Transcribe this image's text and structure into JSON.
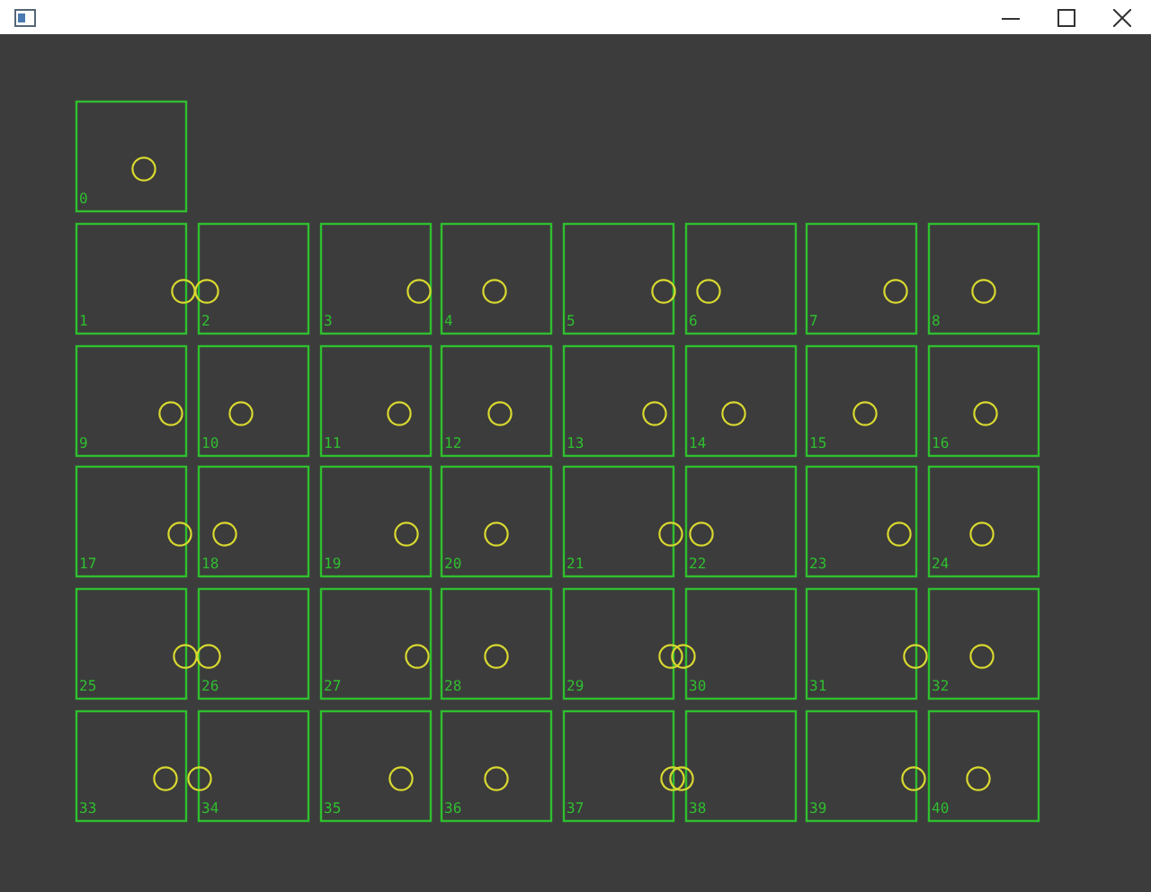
{
  "window": {
    "controls": [
      {
        "kind": "minimize"
      },
      {
        "kind": "maximize"
      },
      {
        "kind": "close"
      }
    ]
  },
  "cells": [
    {
      "label": "0"
    },
    {
      "label": "1"
    },
    {
      "label": "2"
    },
    {
      "label": "3"
    },
    {
      "label": "4"
    },
    {
      "label": "5"
    },
    {
      "label": "6"
    },
    {
      "label": "7"
    },
    {
      "label": "8"
    },
    {
      "label": "9"
    },
    {
      "label": "10"
    },
    {
      "label": "11"
    },
    {
      "label": "12"
    },
    {
      "label": "13"
    },
    {
      "label": "14"
    },
    {
      "label": "15"
    },
    {
      "label": "16"
    },
    {
      "label": "17"
    },
    {
      "label": "18"
    },
    {
      "label": "19"
    },
    {
      "label": "20"
    },
    {
      "label": "21"
    },
    {
      "label": "22"
    },
    {
      "label": "23"
    },
    {
      "label": "24"
    },
    {
      "label": "25"
    },
    {
      "label": "26"
    },
    {
      "label": "27"
    },
    {
      "label": "28"
    },
    {
      "label": "29"
    },
    {
      "label": "30"
    },
    {
      "label": "31"
    },
    {
      "label": "32"
    },
    {
      "label": "33"
    },
    {
      "label": "34"
    },
    {
      "label": "35"
    },
    {
      "label": "36"
    },
    {
      "label": "37"
    },
    {
      "label": "38"
    },
    {
      "label": "39"
    },
    {
      "label": "40"
    }
  ]
}
